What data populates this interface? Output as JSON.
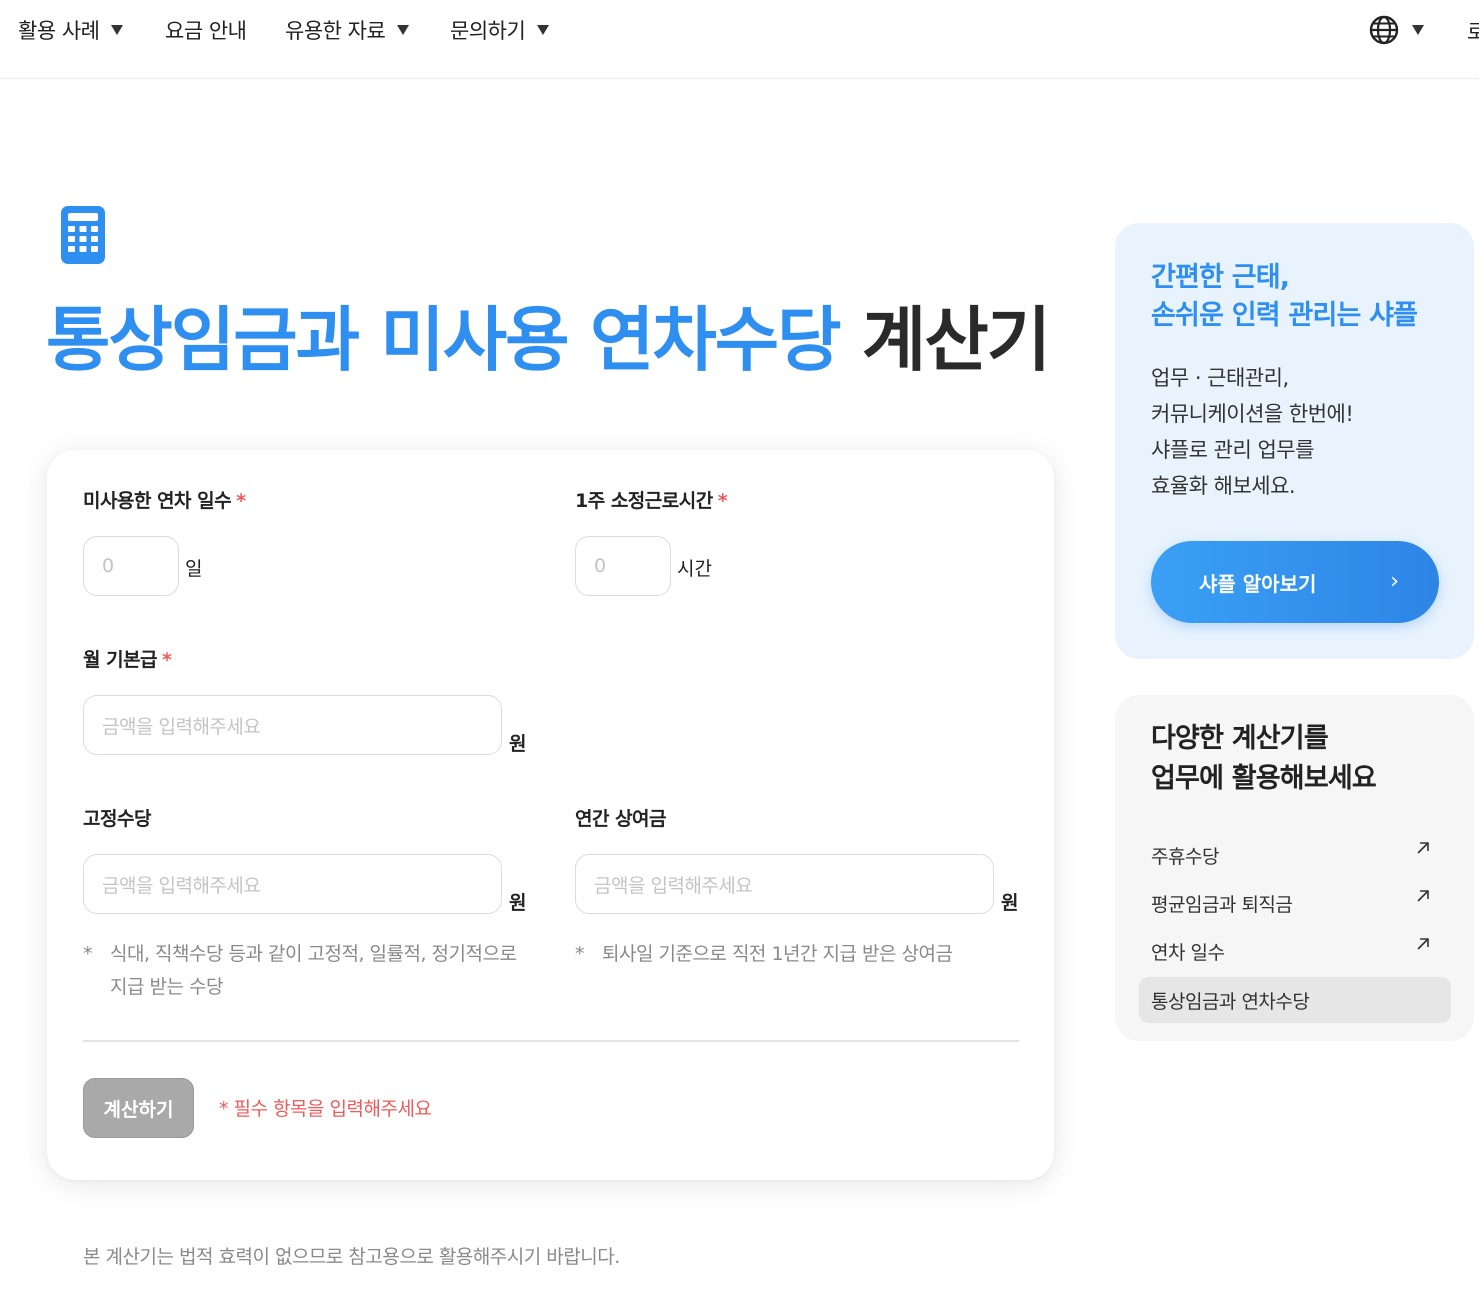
{
  "nav": {
    "items": [
      {
        "label": "활용 사례",
        "has_dropdown": true
      },
      {
        "label": "요금 안내",
        "has_dropdown": false
      },
      {
        "label": "유용한 자료",
        "has_dropdown": true
      },
      {
        "label": "문의하기",
        "has_dropdown": true
      }
    ],
    "language_icon": "globe-icon",
    "cut_label": "로"
  },
  "hero": {
    "icon": "calculator-icon",
    "title_blue": "통상임금과 미사용 연차수당",
    "title_dark": "계산기"
  },
  "form": {
    "unused_days": {
      "label": "미사용한 연차 일수",
      "required_mark": "*",
      "placeholder": "0",
      "unit": "일"
    },
    "weekly_hours": {
      "label": "1주 소정근로시간",
      "required_mark": "*",
      "placeholder": "0",
      "unit": "시간"
    },
    "base_salary": {
      "label": "월 기본급",
      "required_mark": "*",
      "placeholder": "금액을 입력해주세요",
      "unit": "원"
    },
    "fixed_allowance": {
      "label": "고정수당",
      "placeholder": "금액을 입력해주세요",
      "unit": "원",
      "note_mark": "*",
      "note": "식대, 직책수당 등과 같이 고정적, 일률적, 정기적으로 지급 받는 수당"
    },
    "annual_bonus": {
      "label": "연간 상여금",
      "placeholder": "금액을 입력해주세요",
      "unit": "원",
      "note_mark": "*",
      "note": "퇴사일 기준으로 직전 1년간 지급 받은 상여금"
    },
    "submit_label": "계산하기",
    "warning": "* 필수 항목을 입력해주세요"
  },
  "disclaimer": "본 계산기는 법적 효력이 없으므로 참고용으로 활용해주시기 바랍니다.",
  "promo": {
    "title_line1": "간편한 근태,",
    "title_line2": "손쉬운 인력 관리는 샤플",
    "body": [
      "업무 · 근태관리,",
      "커뮤니케이션을 한번에!",
      "샤플로 관리 업무를",
      "효율화 해보세요."
    ],
    "button_label": "샤플 알아보기",
    "button_chevron": "›"
  },
  "calc_list": {
    "title_line1": "다양한 계산기를",
    "title_line2": "업무에 활용해보세요",
    "items": [
      {
        "label": "주휴수당",
        "active": false
      },
      {
        "label": "평균임금과 퇴직금",
        "active": false
      },
      {
        "label": "연차 일수",
        "active": false
      },
      {
        "label": "통상임금과 연차수당",
        "active": true
      }
    ]
  },
  "colors": {
    "accent": "#2f8ff0",
    "required": "#ef5b5b",
    "promo_bg": "#e8f3fe",
    "button_disabled": "#a9a9a9"
  }
}
